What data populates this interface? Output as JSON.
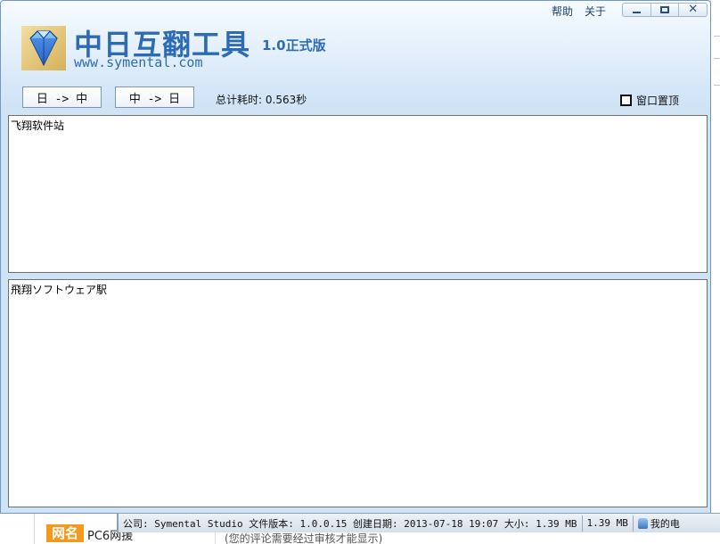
{
  "window": {
    "title": "中日互翻工具",
    "version": "1.0正式版",
    "url": "www.symental.com",
    "help_label": "帮助",
    "about_label": "关于"
  },
  "toolbar": {
    "jp_to_cn_label": "日 -> 中",
    "cn_to_jp_label": "中 -> 日",
    "timing_label": "总计耗时:",
    "timing_value": "0.563秒",
    "ontop_label": "窗口置顶",
    "ontop_checked": false
  },
  "panes": {
    "chinese_text": "飞翔软件站",
    "japanese_text": "飛翔ソフトウェア駅"
  },
  "statusbar": {
    "file_info": "公司: Symental Studio 文件版本: 1.0.0.15 创建日期: 2013-07-18 19:07 大小: 1.39 MB",
    "size": "1.39 MB",
    "computer_label": "我的电"
  },
  "background": {
    "badge": "网名",
    "text": "PC6网援",
    "sub": "(您的评论需要经过审核才能显示)"
  },
  "colors": {
    "brand_blue": "#2d6cb5",
    "window_border": "#6f98c4",
    "badge_orange": "#f39a1e"
  },
  "icons": {
    "logo": "diamond-gem-icon",
    "minimize": "minimize-icon",
    "maximize": "maximize-icon",
    "close": "close-icon",
    "computer": "computer-icon"
  }
}
